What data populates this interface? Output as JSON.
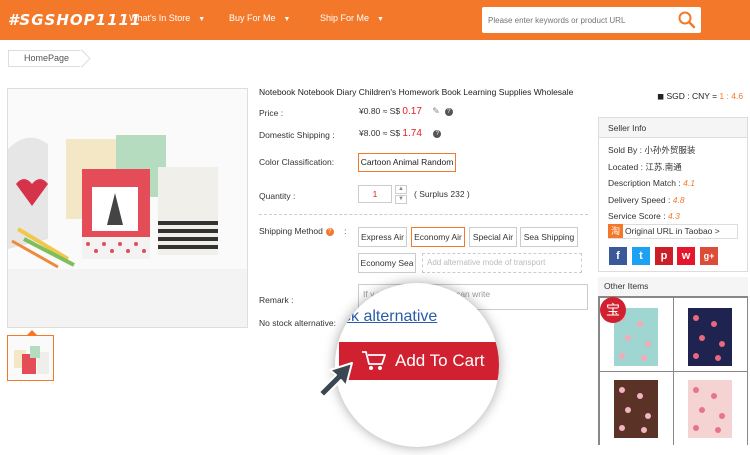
{
  "header": {
    "logo": "#SGSHOP1111",
    "nav": [
      "What's In Store",
      "Buy For Me",
      "Ship For Me"
    ],
    "search_placeholder": "Please enter keywords or product URL",
    "bg_color": "#f4782a"
  },
  "breadcrumb": "HomePage",
  "product": {
    "title": "Notebook Notebook Diary Children's Homework Book Learning Supplies Wholesale",
    "rate_label": "SGD : CNY = ",
    "rate_value": "1 : 4.6",
    "price_label": "Price :",
    "price_cny": "¥0.80 ≈ S$ ",
    "price_sgd": "0.17",
    "domestic_label": "Domestic Shipping :",
    "domestic_cny": "¥8.00 ≈ S$ ",
    "domestic_sgd": "1.74",
    "color_label": "Color Classification:",
    "color_value": "Cartoon Animal Random",
    "quantity_label": "Quantity :",
    "quantity_value": "1",
    "surplus": "( Surplus 232 )",
    "shipping_label": "Shipping Method",
    "shipping_colon": ":",
    "shipping_options": [
      "Express Air",
      "Economy Air",
      "Special Air",
      "Sea Shipping",
      "Economy Sea"
    ],
    "shipping_selected": "Economy Air",
    "shipping_add": "Add alternative mode of transport",
    "remark_label": "Remark :",
    "remark_placeholder": "If y                    nents for goods, you can write",
    "nostock_label": "No stock alternative:",
    "nostock_link": "ck alternative",
    "cart_button": "Add To Cart"
  },
  "seller": {
    "header": "Seller Info",
    "sold_by": "Sold By : 小孙外贸服装",
    "located": "Located : 江苏.南通",
    "desc_label": "Description Match : ",
    "desc_value": "4.1",
    "delivery_label": "Delivery Speed : ",
    "delivery_value": "4.8",
    "service_label": "Service Score : ",
    "service_value": "4.3",
    "taobao_icon": "淘",
    "taobao_link": "Original URL in Taobao >"
  },
  "social": [
    "f",
    "t",
    "p",
    "w",
    "g+"
  ],
  "other_items": {
    "header": "Other Items",
    "badge": "宝"
  }
}
